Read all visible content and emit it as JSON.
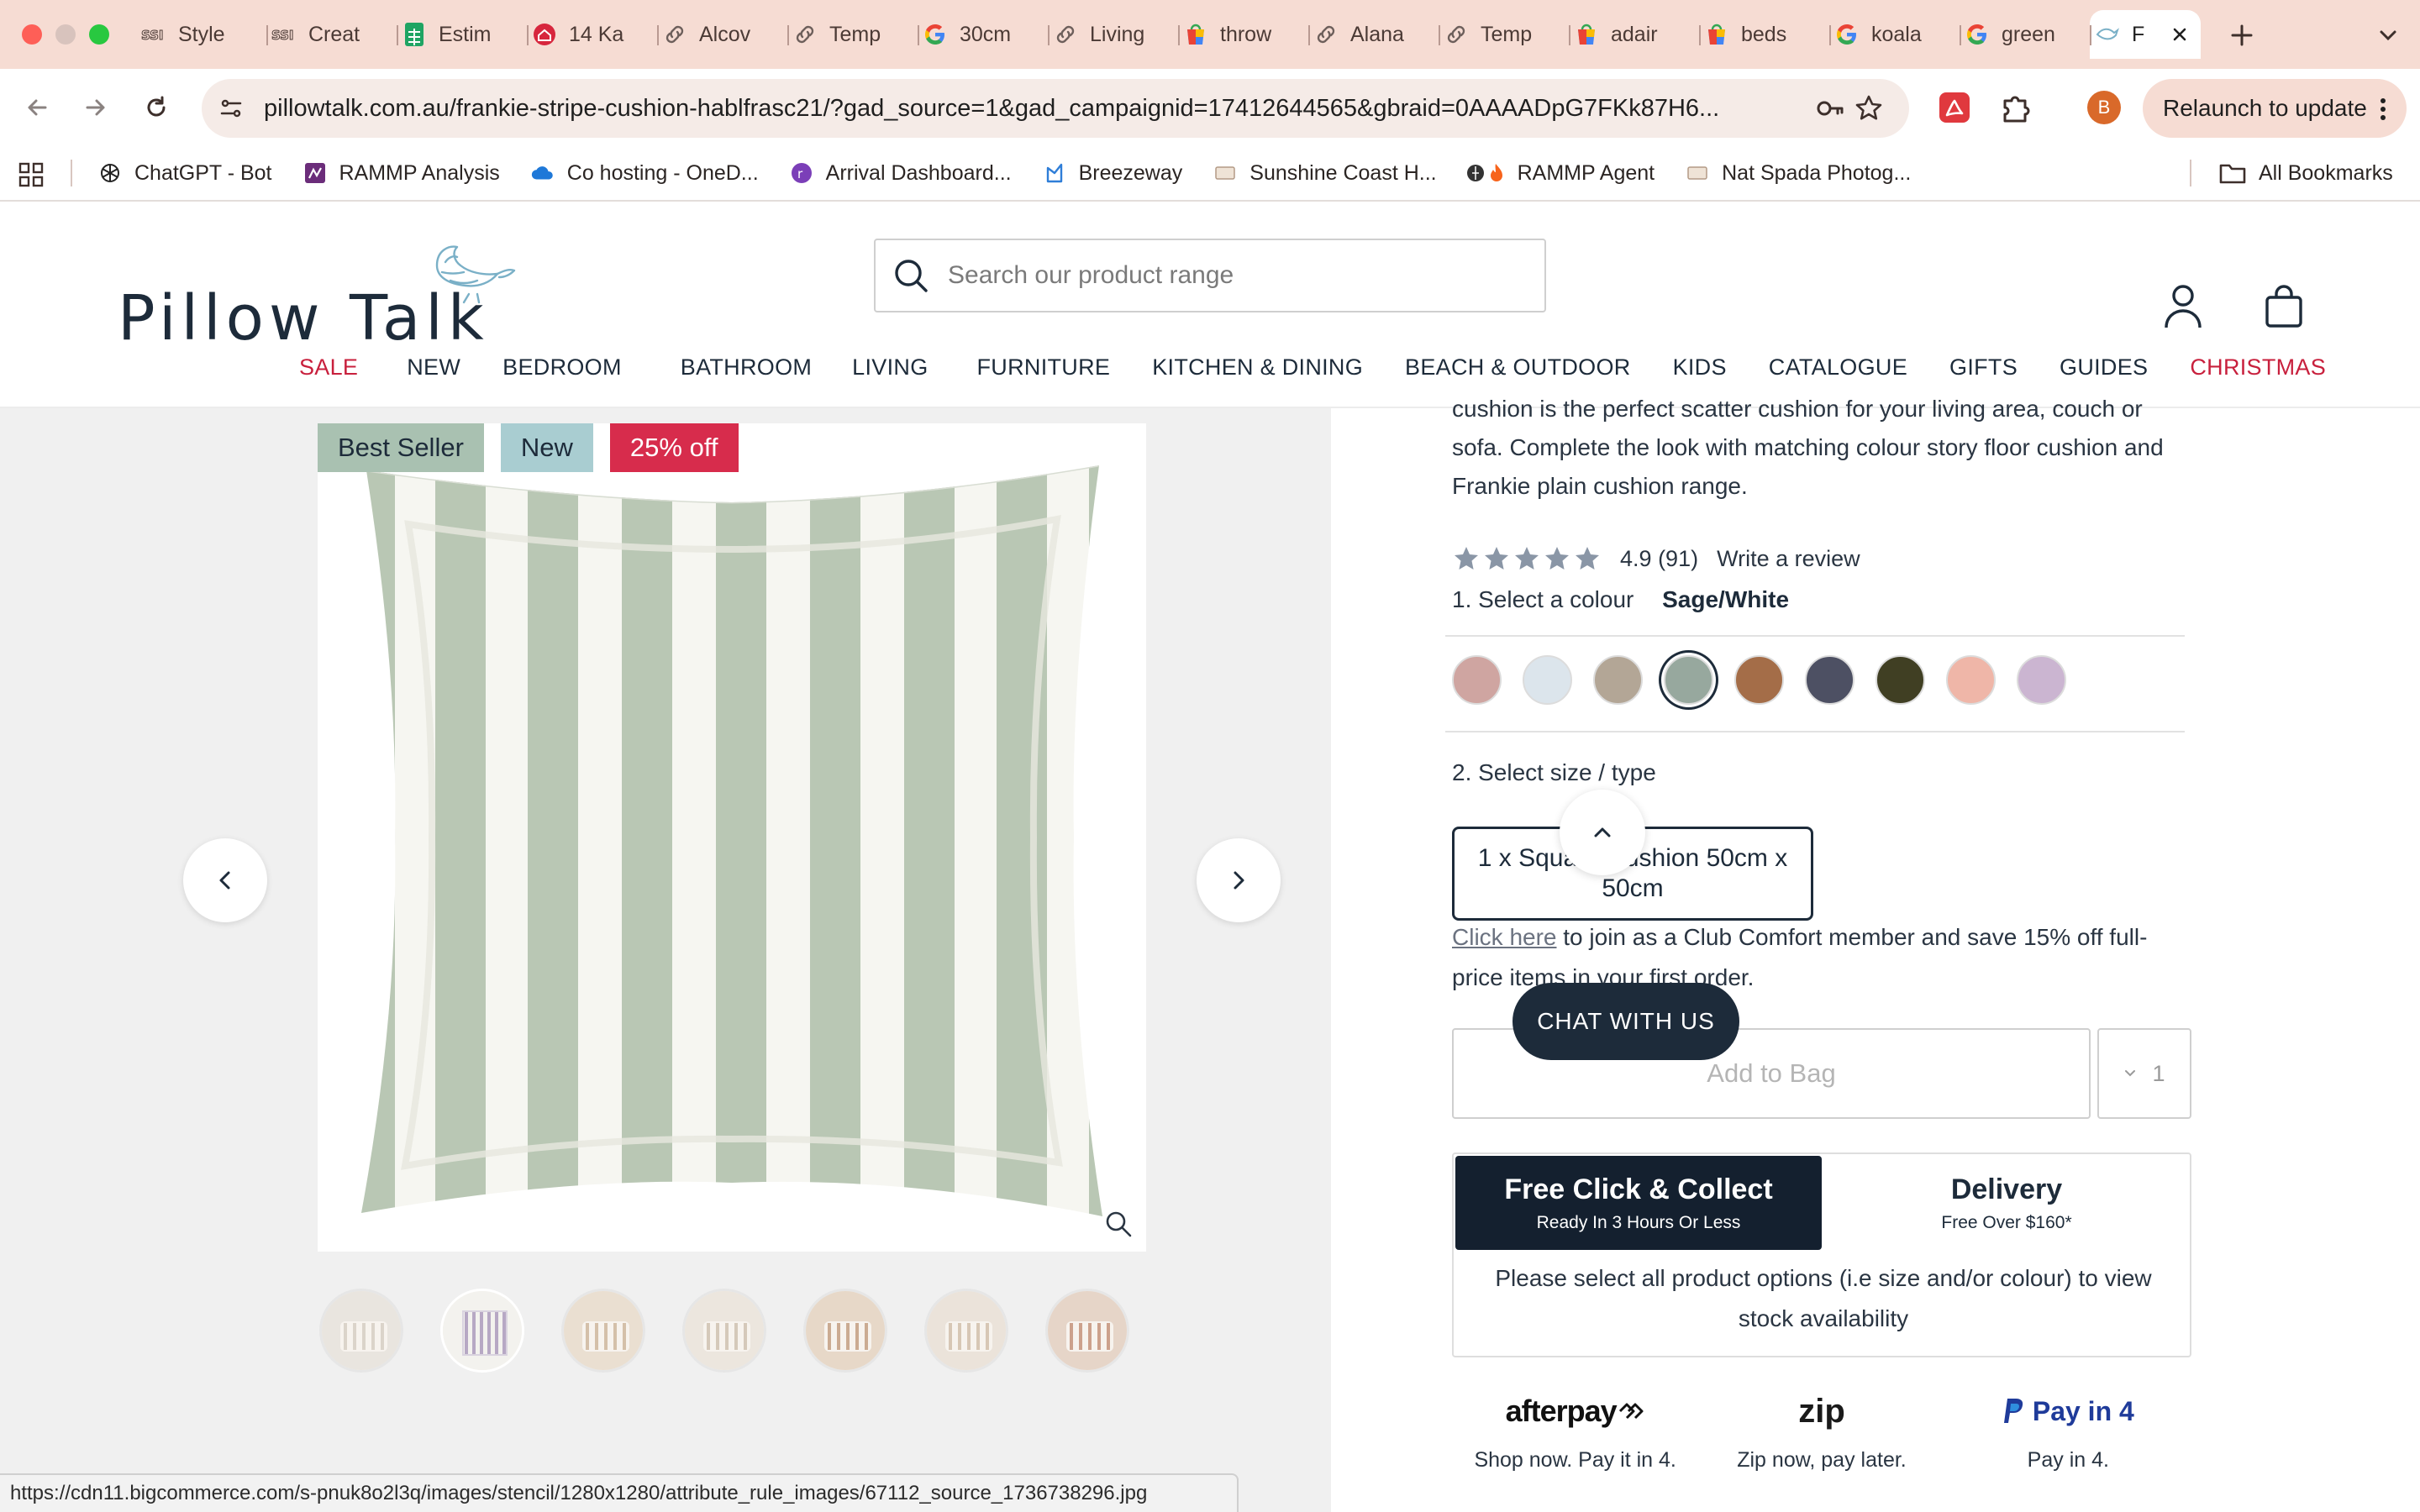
{
  "browser": {
    "tabs": [
      {
        "title": "Style",
        "icon": "s3-icon"
      },
      {
        "title": "Creat",
        "icon": "s3-icon"
      },
      {
        "title": "Estim",
        "icon": "sheets-icon"
      },
      {
        "title": "14 Ka",
        "icon": "home-icon"
      },
      {
        "title": "Alcov",
        "icon": "link-icon"
      },
      {
        "title": "Temp",
        "icon": "link-icon"
      },
      {
        "title": "30cm",
        "icon": "google-icon"
      },
      {
        "title": "Living",
        "icon": "link-icon"
      },
      {
        "title": "throw",
        "icon": "shopping-icon"
      },
      {
        "title": "Alana",
        "icon": "link-icon"
      },
      {
        "title": "Temp",
        "icon": "link-icon"
      },
      {
        "title": "adair",
        "icon": "shopping-icon"
      },
      {
        "title": "beds",
        "icon": "shopping-icon"
      },
      {
        "title": "koala",
        "icon": "google-icon"
      },
      {
        "title": "green",
        "icon": "google-icon"
      },
      {
        "title": "F",
        "icon": "bird-icon",
        "active": true
      }
    ],
    "url": "pillowtalk.com.au/frankie-stripe-cushion-hablfrasc21/?gad_source=1&gad_campaignid=17412644565&gbraid=0AAAADpG7FKk87H6...",
    "relaunch_label": "Relaunch to update",
    "profile_initial": "B",
    "bookmarks": [
      {
        "label": "ChatGPT - Bot",
        "icon": "chatgpt-icon"
      },
      {
        "label": "RAMMP Analysis",
        "icon": "rammp-icon"
      },
      {
        "label": "Co hosting - OneD...",
        "icon": "onedrive-icon"
      },
      {
        "label": "Arrival Dashboard...",
        "icon": "arrival-icon"
      },
      {
        "label": "Breezeway",
        "icon": "breezeway-icon"
      },
      {
        "label": "Sunshine Coast H...",
        "icon": "page-icon"
      },
      {
        "label": "RAMMP Agent",
        "icon": "fire-icon"
      },
      {
        "label": "Nat Spada Photog...",
        "icon": "page-icon"
      }
    ],
    "all_bookmarks_label": "All Bookmarks",
    "status_url": "https://cdn11.bigcommerce.com/s-pnuk8o2l3q/images/stencil/1280x1280/attribute_rule_images/67112_source_1736738296.jpg"
  },
  "site": {
    "logo": "Pillow Talk",
    "search_placeholder": "Search our product range",
    "nav": [
      {
        "label": "SALE",
        "color": "#c8203d"
      },
      {
        "label": "NEW"
      },
      {
        "label": "BEDROOM"
      },
      {
        "label": "BATHROOM"
      },
      {
        "label": "LIVING"
      },
      {
        "label": "FURNITURE"
      },
      {
        "label": "KITCHEN & DINING"
      },
      {
        "label": "BEACH & OUTDOOR"
      },
      {
        "label": "KIDS"
      },
      {
        "label": "CATALOGUE"
      },
      {
        "label": "GIFTS"
      },
      {
        "label": "GUIDES"
      },
      {
        "label": "CHRISTMAS",
        "color": "#c8203d"
      }
    ]
  },
  "gallery": {
    "badges": [
      "Best Seller",
      "New",
      "25% off"
    ],
    "thumbnail_count": 7,
    "active_thumbnail": 2
  },
  "product": {
    "description_partial": "cushion is the perfect scatter cushion for your living area, couch or sofa. Complete the look with matching colour story floor cushion and Frankie plain cushion range.",
    "rating": "4.9",
    "review_count": "(91)",
    "rating_stars": 5,
    "write_review": "Write a review",
    "colour_label": "1. Select a colour",
    "selected_colour": "Sage/White",
    "swatches": [
      "#cfa5a1",
      "#dce5ec",
      "#b3a696",
      "#97a89e",
      "#a46d48",
      "#4d5063",
      "#403f23",
      "#efb6a8",
      "#cbb5d1"
    ],
    "selected_swatch": 3,
    "size_label": "2. Select size / type",
    "size_option": "1 x Square Cushion 50cm x 50cm",
    "club_link": "Click here",
    "club_text": " to join as a Club Comfort member and save 15% off full-price items in your first order.",
    "add_to_bag": "Add to Bag",
    "quantity": "1",
    "fulfilment": {
      "collect_title": "Free Click & Collect",
      "collect_sub": "Ready In 3 Hours Or Less",
      "delivery_title": "Delivery",
      "delivery_sub": "Free Over $160*",
      "note": "Please select all product options (i.e size and/or colour) to view stock availability"
    },
    "payments": [
      {
        "logo": "afterpay",
        "caption": "Shop now. Pay it in 4."
      },
      {
        "logo": "zip",
        "caption": "Zip now, pay later."
      },
      {
        "logo": "Pay in 4",
        "caption": "Pay in 4."
      }
    ],
    "chat_label": "CHAT WITH US"
  }
}
